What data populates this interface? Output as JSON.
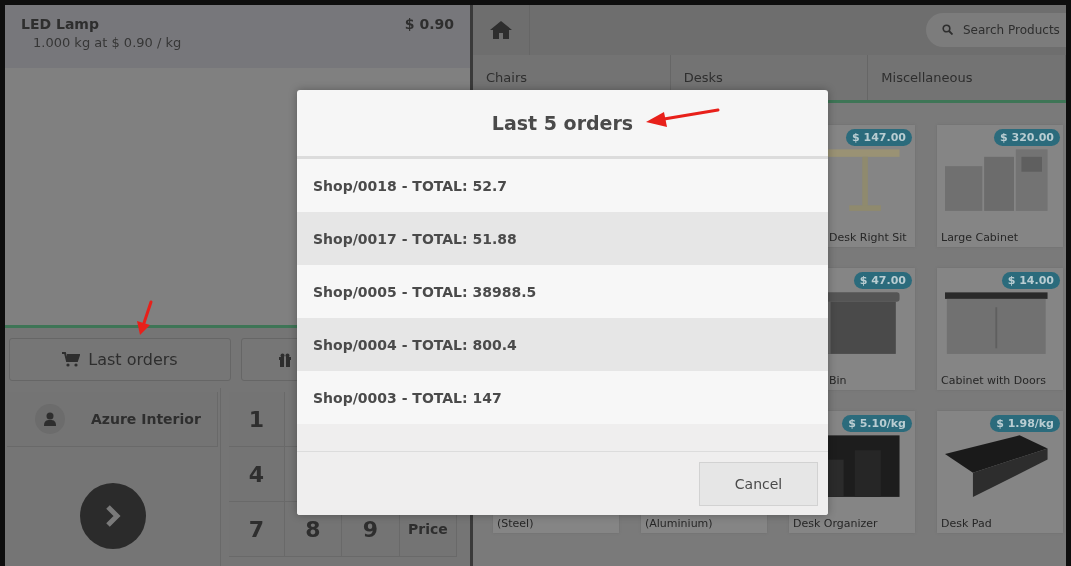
{
  "order_line": {
    "product": "LED Lamp",
    "price": "$ 0.90",
    "detail": "1.000 kg at $ 0.90 / kg"
  },
  "action_buttons": [
    {
      "label": "Last orders"
    }
  ],
  "customer": {
    "name": "Azure Interior"
  },
  "numpad_rows": [
    [
      "1"
    ],
    [
      "4"
    ],
    [
      "7",
      "8",
      "9",
      "Price"
    ]
  ],
  "search": {
    "placeholder": "Search Products"
  },
  "categories": [
    "Chairs",
    "Desks",
    "Miscellaneous"
  ],
  "product_rows": [
    [
      {
        "name": "Desk Right Sit",
        "price": "$ 147.00",
        "kind": "picture"
      },
      {
        "name": "Large Cabinet",
        "price": "$ 320.00",
        "kind": "picture"
      }
    ],
    [
      {
        "name": "Bin",
        "price": "$ 47.00",
        "kind": "picture"
      },
      {
        "name": "Cabinet with Doors",
        "price": "$ 14.00",
        "kind": "picture"
      }
    ],
    [
      {
        "name": "(Steel)"
      },
      {
        "name": "(Aluminium)"
      },
      {
        "name": "Desk Organizer",
        "price": "$ 5.10/kg",
        "kind": "picture"
      },
      {
        "name": "Desk Pad",
        "price": "$ 1.98/kg",
        "kind": "picture"
      }
    ]
  ],
  "dialog": {
    "title": "Last 5 orders",
    "orders": [
      "Shop/0018 - TOTAL: 52.7",
      "Shop/0017 - TOTAL: 51.88",
      "Shop/0005 - TOTAL: 38988.5",
      "Shop/0004 - TOTAL: 800.4",
      "Shop/0003 - TOTAL: 147"
    ],
    "cancel": "Cancel"
  }
}
